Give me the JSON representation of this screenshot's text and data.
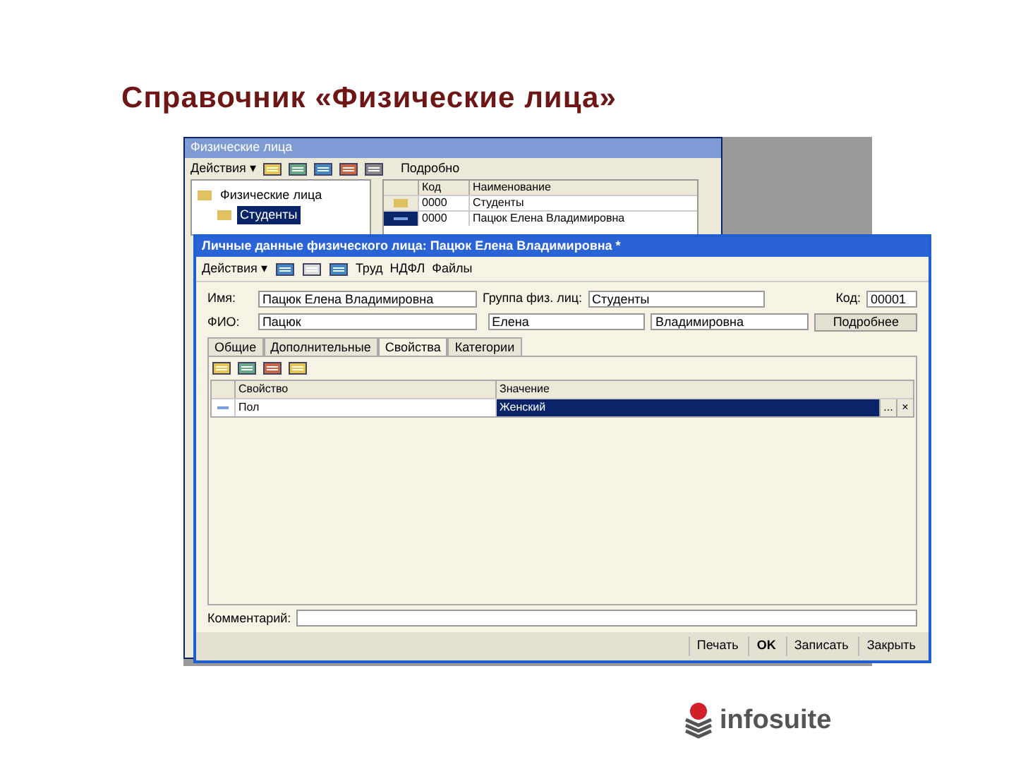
{
  "slide_title": "Справочник «Физические лица»",
  "back_window": {
    "title": "Физические лица",
    "toolbar": {
      "actions": "Действия",
      "actions_caret": "▾",
      "details": "Подробно"
    },
    "tree": [
      {
        "label": "Физические лица",
        "selected": false,
        "children": [
          {
            "label": "Студенты",
            "selected": true
          }
        ]
      }
    ],
    "table": {
      "columns": [
        "Код",
        "Наименование"
      ],
      "rows": [
        {
          "kind": "folder",
          "code": "0000",
          "name": "Студенты",
          "selected": false
        },
        {
          "kind": "item",
          "code": "0000",
          "name": "Пацюк Елена Владимировна",
          "selected": true
        }
      ]
    }
  },
  "front_window": {
    "title": "Личные данные физического лица: Пацюк Елена Владимировна *",
    "toolbar": {
      "actions": "Действия",
      "actions_caret": "▾",
      "labor": "Труд",
      "ndfl": "НДФЛ",
      "files": "Файлы"
    },
    "name_label": "Имя:",
    "name_value": "Пацюк Елена Владимировна",
    "group_label": "Группа физ. лиц:",
    "group_value": "Студенты",
    "code_label": "Код:",
    "code_value": "00001",
    "fio_label": "ФИО:",
    "surname": "Пацюк",
    "first_name": "Елена",
    "patronymic": "Владимировна",
    "details_button": "Подробнее",
    "tabs": [
      {
        "label": "Общие",
        "selected": false
      },
      {
        "label": "Дополнительные",
        "selected": false
      },
      {
        "label": "Свойства",
        "selected": true
      },
      {
        "label": "Категории",
        "selected": false
      }
    ],
    "table": {
      "columns": [
        "Свойство",
        "Значение"
      ],
      "rows": [
        {
          "property": "Пол",
          "value": "Женский",
          "selected": true,
          "choose_button": "...",
          "clear_button": "×"
        }
      ]
    },
    "comment_label": "Комментарий:",
    "buttons": [
      "Печать",
      "OK",
      "Записать",
      "Закрыть"
    ]
  },
  "logo": "infosuite"
}
